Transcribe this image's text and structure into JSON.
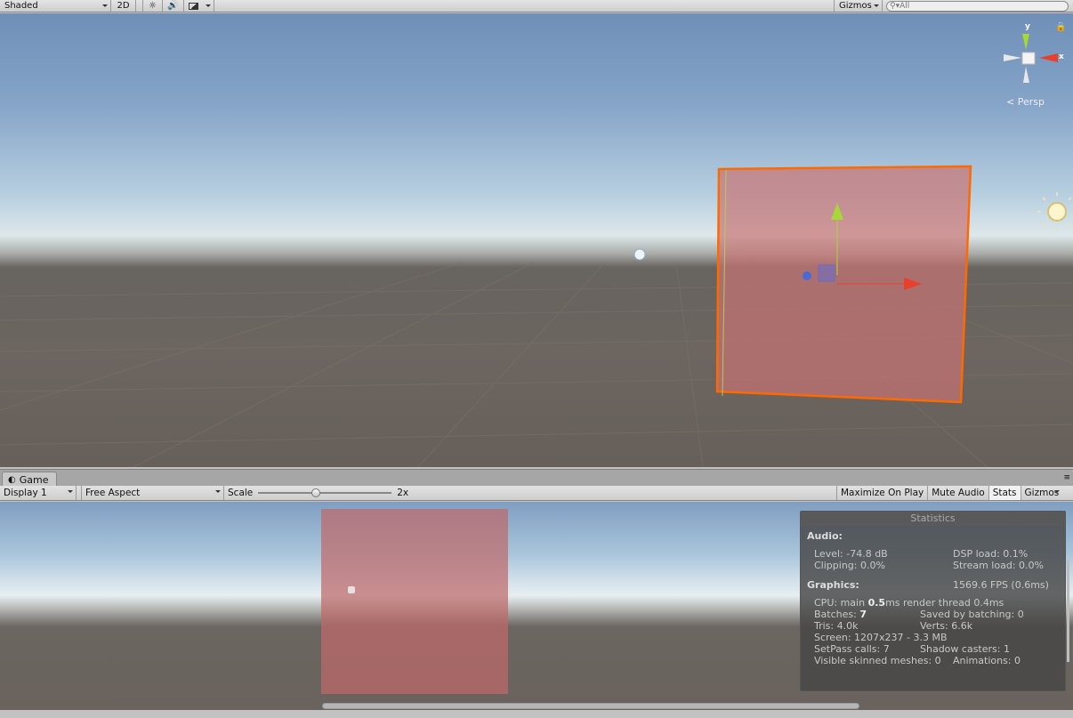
{
  "scene_toolbar": {
    "shading_mode": "Shaded",
    "mode_2d": "2D",
    "gizmos_label": "Gizmos",
    "search_placeholder": "All"
  },
  "scene_view": {
    "gizmo_axis_y": "y",
    "gizmo_axis_x": "x",
    "projection_label": "Persp"
  },
  "game_panel": {
    "tab_label": "Game",
    "display": "Display 1",
    "aspect": "Free Aspect",
    "scale_label": "Scale",
    "scale_value": "2x",
    "scale_level": 0.43,
    "buttons": {
      "maximize": "Maximize On Play",
      "mute": "Mute Audio",
      "stats": "Stats",
      "gizmos": "Gizmos"
    }
  },
  "statistics": {
    "title": "Statistics",
    "audio_header": "Audio:",
    "level": "Level: -74.8 dB",
    "dsp_load": "DSP load: 0.1%",
    "clipping": "Clipping: 0.0%",
    "stream_load": "Stream load: 0.0%",
    "graphics_header": "Graphics:",
    "fps": "1569.6 FPS (0.6ms)",
    "cpu_prefix": "CPU: main ",
    "cpu_main": "0.5",
    "cpu_suffix": "ms  render thread 0.4ms",
    "batches_prefix": "Batches: ",
    "batches": "7",
    "saved_by_batching": "Saved by batching: 0",
    "tris": "Tris: 4.0k",
    "verts": "Verts: 6.6k",
    "screen": "Screen: 1207x237 - 3.3 MB",
    "setpass": "SetPass calls: 7",
    "shadow_casters": "Shadow casters: 1",
    "skinned_meshes": "Visible skinned meshes: 0",
    "animations": "Animations: 0"
  },
  "colors": {
    "selection_outline": "#ff6a00",
    "cube_fill": "#c87878",
    "axis_x": "#e8402a",
    "axis_y": "#a8d838",
    "axis_z": "#4a6ad8"
  },
  "icons": [
    "sun-icon",
    "audio-icon",
    "image-effects-icon",
    "search-icon",
    "lock-icon",
    "light-gizmo-icon",
    "camera-gizmo-icon",
    "game-tab-icon",
    "panel-menu-icon"
  ]
}
